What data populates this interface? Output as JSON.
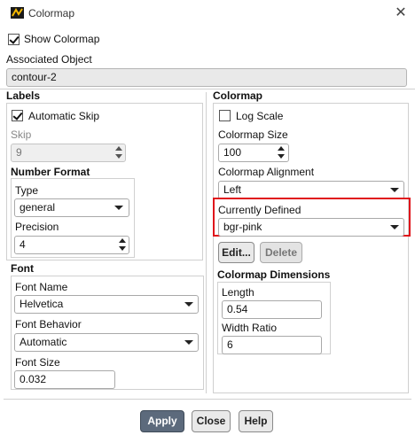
{
  "window": {
    "title": "Colormap",
    "close_glyph": "✕"
  },
  "show_colormap": {
    "label": "Show Colormap",
    "checked": true
  },
  "associated_object": {
    "label": "Associated Object",
    "value": "contour-2"
  },
  "labels": {
    "heading": "Labels",
    "automatic_skip": {
      "label": "Automatic Skip",
      "checked": true
    },
    "skip": {
      "label": "Skip",
      "value": "9"
    },
    "number_format": {
      "heading": "Number Format",
      "type_label": "Type",
      "type_value": "general",
      "precision_label": "Precision",
      "precision_value": "4"
    }
  },
  "font": {
    "heading": "Font",
    "name_label": "Font Name",
    "name_value": "Helvetica",
    "behavior_label": "Font Behavior",
    "behavior_value": "Automatic",
    "size_label": "Font Size",
    "size_value": "0.032"
  },
  "colormap": {
    "heading": "Colormap",
    "log_scale": {
      "label": "Log Scale",
      "checked": false
    },
    "size_label": "Colormap Size",
    "size_value": "100",
    "alignment_label": "Colormap Alignment",
    "alignment_value": "Left",
    "currently_defined_label": "Currently Defined",
    "currently_defined_value": "bgr-pink",
    "edit_button": "Edit...",
    "delete_button": "Delete",
    "dimensions": {
      "heading": "Colormap Dimensions",
      "length_label": "Length",
      "length_value": "0.54",
      "width_ratio_label": "Width Ratio",
      "width_ratio_value": "6"
    }
  },
  "footer": {
    "apply": "Apply",
    "close": "Close",
    "help": "Help"
  },
  "colors": {
    "highlight": "#e0151b",
    "apply_button": "#5c6a7c",
    "readonly_field": "#e9e9e9"
  },
  "icons": [
    "ansys-app-icon",
    "close-icon",
    "checkbox-checked-icon",
    "checkbox-unchecked-icon",
    "spinner-arrows-icon",
    "dropdown-arrow-icon"
  ]
}
